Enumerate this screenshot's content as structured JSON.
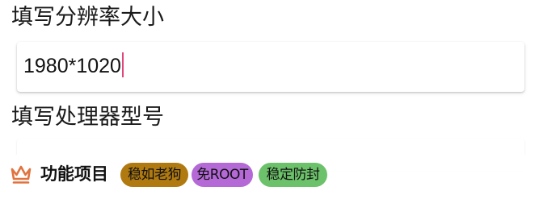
{
  "form": {
    "resolution": {
      "label": "填写分辨率大小",
      "value": "1980*1020"
    },
    "cpu_model": {
      "label": "填写处理器型号",
      "value": ""
    }
  },
  "features": {
    "icon": "crown-icon",
    "title": "功能项目",
    "badges": [
      {
        "label": "稳如老狗",
        "color": "#b07a10"
      },
      {
        "label": "免ROOT",
        "color": "#b469d6"
      },
      {
        "label": "稳定防封",
        "color": "#6cc26a"
      }
    ]
  },
  "colors": {
    "caret": "#e0457b",
    "crown": "#e0733f"
  }
}
